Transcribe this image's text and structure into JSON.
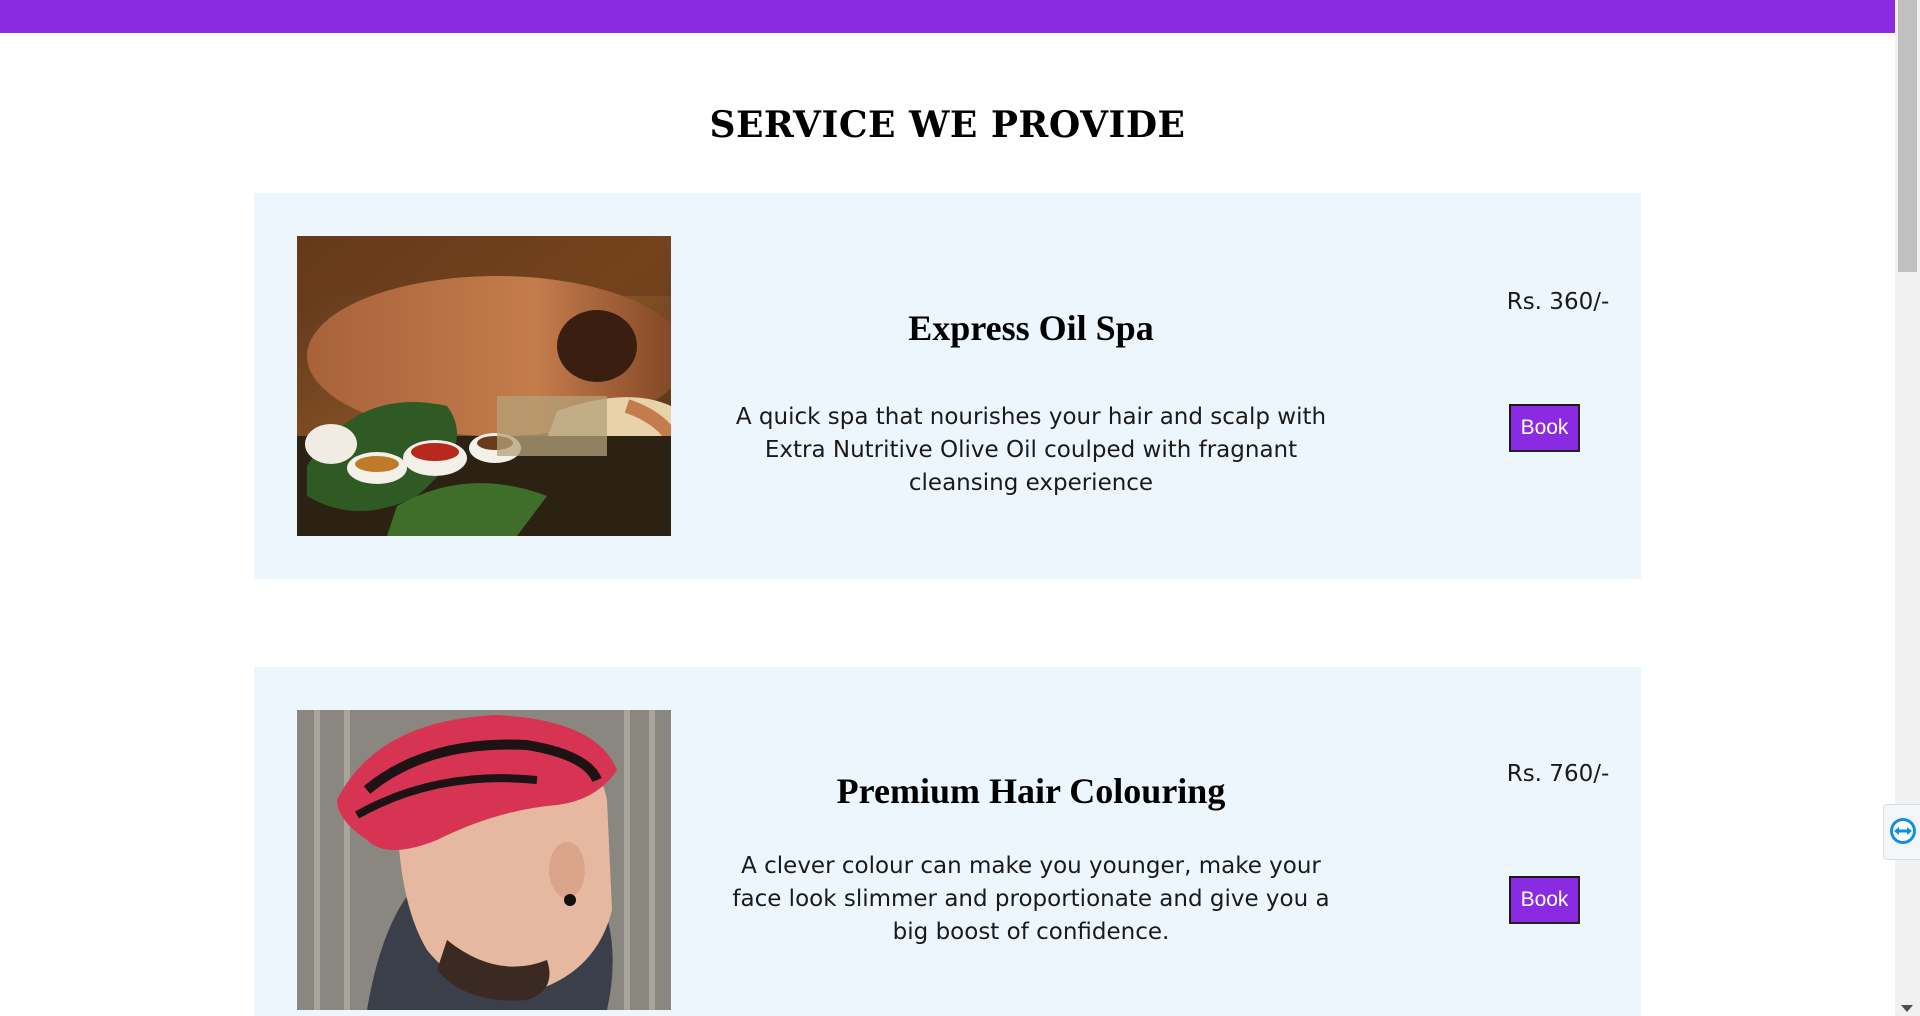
{
  "page": {
    "heading": "SERVICE WE PROVIDE",
    "accent_color": "#8a2be2",
    "card_background": "#eef6fd"
  },
  "services": [
    {
      "title": "Express Oil Spa",
      "description": "A quick spa that nourishes your hair and scalp with Extra Nutritive Olive Oil coulped with fragnant cleansing experience",
      "price": "Rs. 360/-",
      "button_label": "Book",
      "image": "spa-massage-photo"
    },
    {
      "title": "Premium Hair Colouring",
      "description": "A clever colour can make you younger, make your face look slimmer and proportionate and give you a big boost of confidence.",
      "price": "Rs. 760/-",
      "button_label": "Book",
      "image": "hair-colouring-photo"
    }
  ],
  "widgets": {
    "side_tab_icon": "teamviewer-icon"
  }
}
